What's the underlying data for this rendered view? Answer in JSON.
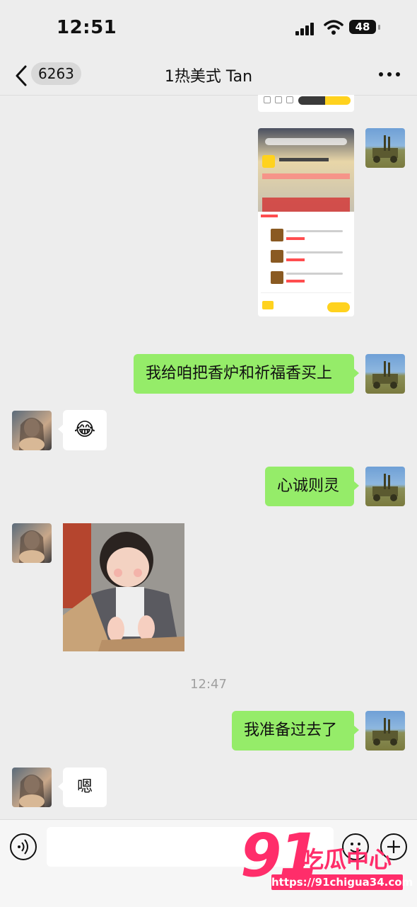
{
  "status_bar": {
    "time": "12:51",
    "battery": "48"
  },
  "nav": {
    "unread_count": "6263",
    "title": "1热美式 Tan"
  },
  "messages": [
    {
      "type": "image",
      "side": "me",
      "description_icon": "shopping-screenshot"
    },
    {
      "type": "text",
      "side": "me",
      "text": "我给咱把香炉和祈福香买上"
    },
    {
      "type": "emoji",
      "side": "her",
      "text": "😂"
    },
    {
      "type": "text",
      "side": "me",
      "text": "心诚则灵"
    },
    {
      "type": "image",
      "side": "her",
      "description_icon": "baby-photo"
    },
    {
      "type": "text",
      "side": "me",
      "text": "我准备过去了"
    },
    {
      "type": "text",
      "side": "her",
      "text": "嗯"
    }
  ],
  "timestamp": "12:47",
  "input": {
    "placeholder": ""
  },
  "watermark": {
    "logo": "91",
    "name": "吃瓜中心",
    "url": "https://91chigua34.com"
  },
  "colors": {
    "my_bubble": "#95ec69",
    "her_bubble": "#ffffff",
    "background": "#ededed",
    "watermark": "#ff2d6a"
  }
}
